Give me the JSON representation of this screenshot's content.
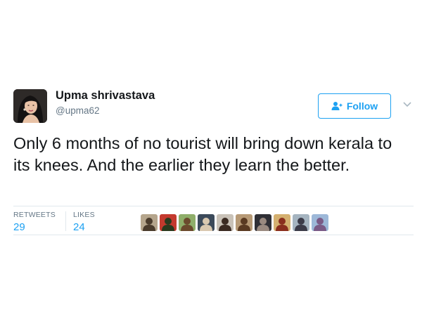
{
  "author": {
    "display_name": "Upma shrivastava",
    "handle": "@upma62",
    "avatar_icon": "profile-photo-woman"
  },
  "follow_button": {
    "label": "Follow",
    "icon": "add-user-icon",
    "color": "#1da1f2"
  },
  "tweet": {
    "text": "Only 6 months of no tourist will bring down kerala to its knees. And the earlier they learn the better."
  },
  "stats": {
    "retweets_label": "RETWEETS",
    "retweets_count": "29",
    "likes_label": "LIKES",
    "likes_count": "24"
  },
  "likers": [
    {
      "icon": "liker-avatar-icon",
      "bg": "#b5a58c",
      "fg": "#4a3b2c"
    },
    {
      "icon": "liker-avatar-icon",
      "bg": "#c43a2e",
      "fg": "#2b3a1e"
    },
    {
      "icon": "liker-avatar-icon",
      "bg": "#8fae6a",
      "fg": "#6b4a2d"
    },
    {
      "icon": "liker-avatar-icon",
      "bg": "#3c4a5a",
      "fg": "#d9c8b0"
    },
    {
      "icon": "liker-avatar-icon",
      "bg": "#c9c2b8",
      "fg": "#3a2a22"
    },
    {
      "icon": "liker-avatar-icon",
      "bg": "#b79a76",
      "fg": "#5a3a22"
    },
    {
      "icon": "liker-avatar-icon",
      "bg": "#2f2f35",
      "fg": "#9a8a80"
    },
    {
      "icon": "liker-avatar-icon",
      "bg": "#d4b070",
      "fg": "#8a2e1e"
    },
    {
      "icon": "liker-avatar-icon",
      "bg": "#a5b4c0",
      "fg": "#3b3b48"
    },
    {
      "icon": "liker-avatar-icon",
      "bg": "#9db8d8",
      "fg": "#7a5a86"
    }
  ],
  "colors": {
    "accent": "#1da1f2",
    "text": "#14171a",
    "secondary_text": "#657786",
    "divider": "#e1e8ed"
  }
}
